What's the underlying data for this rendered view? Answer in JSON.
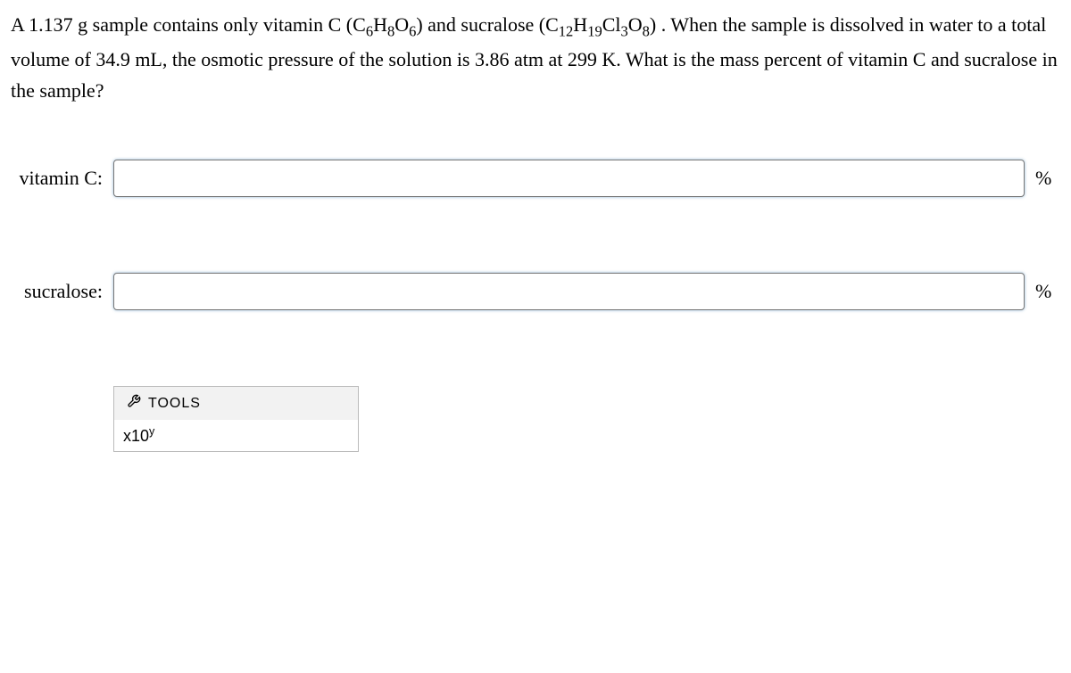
{
  "question": {
    "part1": "A 1.137 g sample contains only vitamin C (C",
    "sub1": "6",
    "part2": "H",
    "sub2": "8",
    "part3": "O",
    "sub3": "6",
    "part4": ") and sucralose (C",
    "sub4": "12",
    "part5": "H",
    "sub5": "19",
    "part6": "Cl",
    "sub6": "3",
    "part7": "O",
    "sub7": "8",
    "part8": ") . When the sample is dissolved in water to a total volume of 34.9 mL, the osmotic pressure of the solution is 3.86 atm at 299 K. What is the mass percent of vitamin C and sucralose in the sample?"
  },
  "answers": [
    {
      "label": "vitamin C:",
      "value": "",
      "unit": "%"
    },
    {
      "label": "sucralose:",
      "value": "",
      "unit": "%"
    }
  ],
  "tools": {
    "header": "TOOLS",
    "sci_base": "x10",
    "sci_exp": "y"
  }
}
